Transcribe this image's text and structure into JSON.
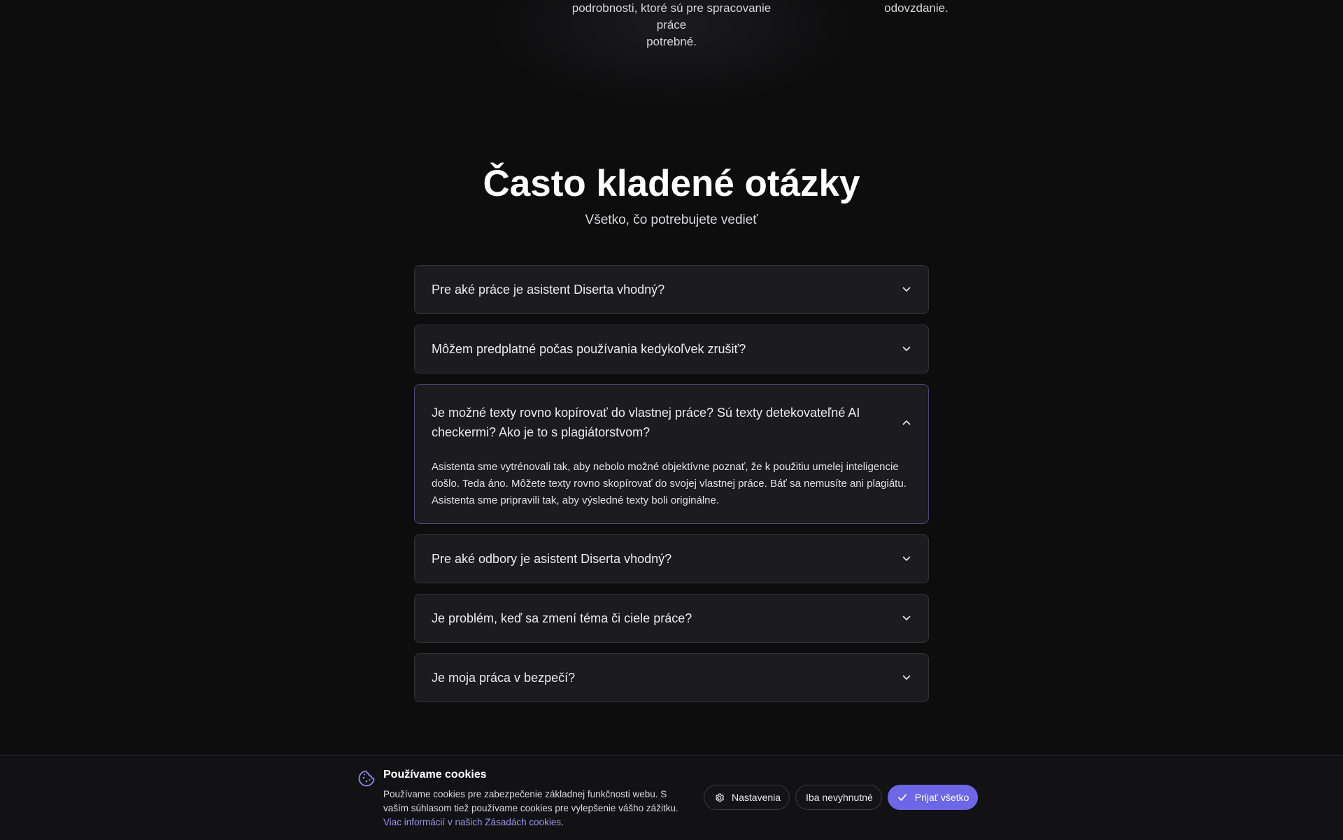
{
  "top_section": {
    "mid_text_line1": "podrobnosti, ktoré sú pre spracovanie práce",
    "mid_text_line2": "potrebné.",
    "right_text": "odovzdanie."
  },
  "faq": {
    "title": "Často kladené otázky",
    "subtitle": "Všetko, čo potrebujete vedieť",
    "items": [
      {
        "question": "Pre aké práce je asistent Diserta vhodný?",
        "expanded": false
      },
      {
        "question": "Môžem predplatné počas používania kedykoľvek zrušiť?",
        "expanded": false
      },
      {
        "question": "Je možné texty rovno kopírovať do vlastnej práce? Sú texty detekovateľné AI checkermi? Ako je to s plagiátorstvom?",
        "expanded": true,
        "answer": "Asistenta sme vytrénovali tak, aby nebolo možné objektívne poznať, že k použitiu umelej inteligencie došlo. Teda áno. Môžete texty rovno skopírovať do svojej vlastnej práce. Báť sa nemusíte ani plagiátu. Asistenta sme pripravili tak, aby výsledné texty boli originálne."
      },
      {
        "question": "Pre aké odbory je asistent Diserta vhodný?",
        "expanded": false
      },
      {
        "question": "Je problém, keď sa zmení téma či ciele práce?",
        "expanded": false
      },
      {
        "question": "Je moja práca v bezpečí?",
        "expanded": false
      }
    ]
  },
  "cookie_bar": {
    "title": "Používame cookies",
    "text": "Používame cookies pre zabezpečenie základnej funkčnosti webu. S vaším súhlasom tiež používame cookies pre vylepšenie vášho zážitku.",
    "link_text": "Viac informácií v našich Zásadách cookies",
    "link_suffix": ".",
    "settings_label": "Nastavenia",
    "necessary_label": "Iba nevyhnutné",
    "accept_label": "Prijať všetko"
  },
  "colors": {
    "accent": "#6d66e6",
    "background": "#0d0d0e",
    "card": "#1c1c1e"
  },
  "icons": {
    "collapsed": "chevron-down-icon",
    "expanded": "chevron-up-icon",
    "cookie": "cookie-icon",
    "settings": "gear-icon",
    "accept": "check-icon"
  }
}
